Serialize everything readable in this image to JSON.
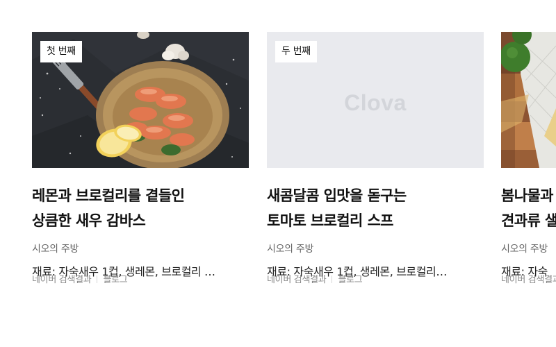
{
  "cards": [
    {
      "badge": "첫 번째",
      "title_line1": "레몬과 브로컬리를 곁들인",
      "title_line2": "상큼한 새우 감바스",
      "source": "시오의 주방",
      "ingredients": "재료: 자숙새우 1컵, 생레몬, 브로컬리 …",
      "meta_origin": "네이버 검색결과",
      "meta_type": "블로그"
    },
    {
      "badge": "두 번째",
      "placeholder_logo": "Clova",
      "title_line1": "새콤달콤 입맛을 돋구는",
      "title_line2": "토마토 브로컬리 스프",
      "source": "시오의 주방",
      "ingredients": "재료: 자숙새우 1컵, 생레몬, 브로컬리…",
      "meta_origin": "네이버 검색결과",
      "meta_type": "블로그"
    },
    {
      "title_line1": "봄나물과",
      "title_line2": "견과류 샐",
      "source": "시오의 주방",
      "ingredients": "재료: 자숙",
      "meta_origin": "네이버 검색결과"
    }
  ]
}
